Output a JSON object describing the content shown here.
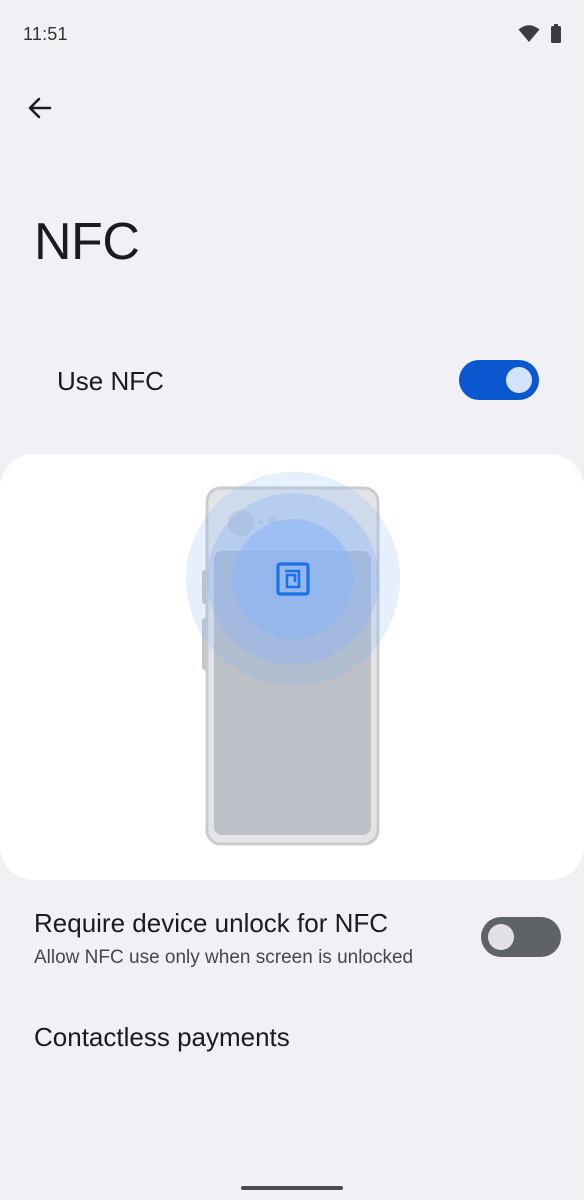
{
  "status_bar": {
    "time": "11:51",
    "icons": [
      "wifi-icon",
      "battery-icon"
    ]
  },
  "header": {
    "back_icon": "arrow-back-icon",
    "title": "NFC"
  },
  "use_nfc": {
    "label": "Use NFC",
    "enabled": true
  },
  "illustration": {
    "icon": "nfc-icon",
    "colors": {
      "pulse": "#8ab4f8",
      "nfc_symbol": "#1a73e8",
      "phone_body": "#c4c7cc"
    }
  },
  "require_unlock": {
    "title": "Require device unlock for NFC",
    "summary": "Allow NFC use only when screen is unlocked",
    "enabled": false
  },
  "contactless_payments": {
    "label": "Contactless payments"
  },
  "colors": {
    "background": "#f1f0f5",
    "accent": "#0b57d0",
    "switch_off_track": "#5f6368"
  }
}
